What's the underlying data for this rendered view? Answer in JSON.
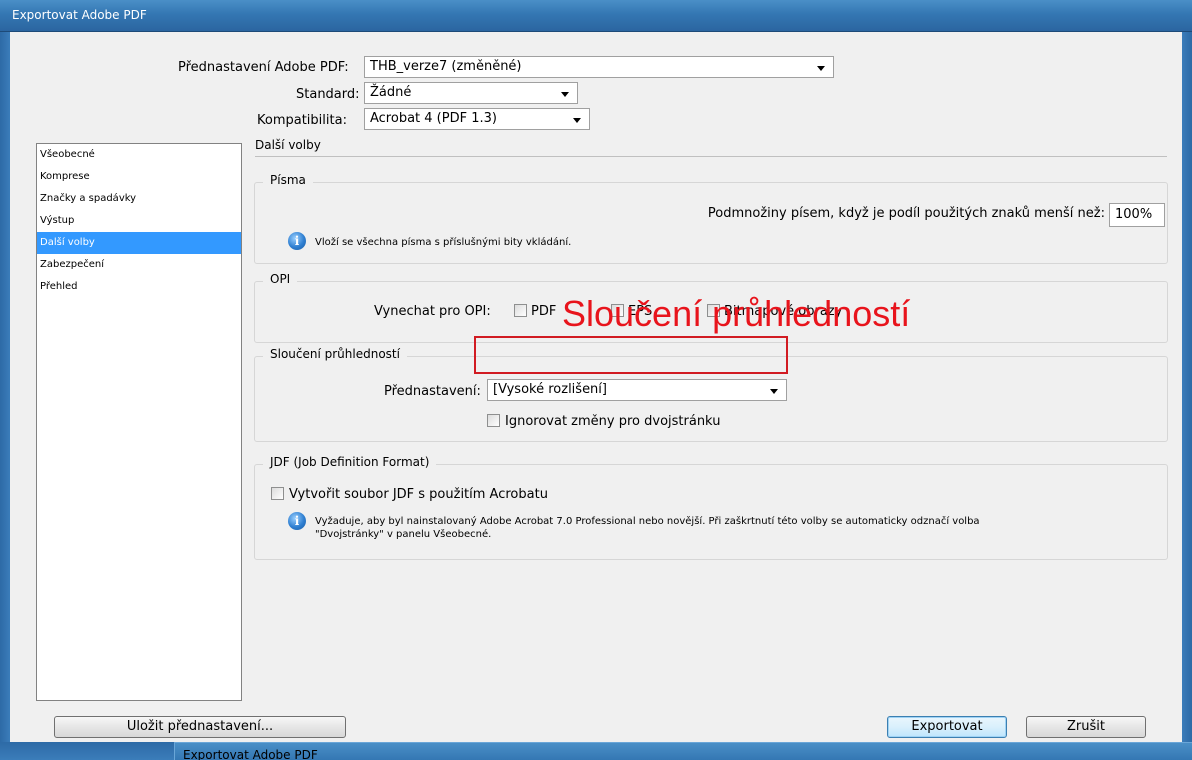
{
  "window": {
    "title": "Exportovat Adobe PDF"
  },
  "presets": {
    "preset_label": "Přednastavení Adobe PDF:",
    "preset_value": "THB_verze7 (změněné)",
    "standard_label": "Standard:",
    "standard_value": "Žádné",
    "compat_label": "Kompatibilita:",
    "compat_value": "Acrobat 4 (PDF 1.3)"
  },
  "sidebar": {
    "items": [
      {
        "label": "Všeobecné"
      },
      {
        "label": "Komprese"
      },
      {
        "label": "Značky a spadávky"
      },
      {
        "label": "Výstup"
      },
      {
        "label": "Další volby"
      },
      {
        "label": "Zabezpečení"
      },
      {
        "label": "Přehled"
      }
    ],
    "selected_index": 4
  },
  "main": {
    "section_title": "Další volby",
    "fonts": {
      "legend": "Písma",
      "subset_label": "Podmnožiny písem, když je podíl použitých znaků menší než:",
      "subset_value": "100%",
      "info": "Vloží se všechna písma s příslušnými bity vkládání."
    },
    "opi": {
      "legend": "OPI",
      "omit_label": "Vynechat pro OPI:",
      "pdf_label": "PDF",
      "eps_label": "EPS",
      "bitmap_label": "Bitmapové obrazy"
    },
    "flattener": {
      "legend": "Sloučení průhledností",
      "preset_label": "Přednastavení:",
      "preset_value": "[Vysoké rozlišení]",
      "ignore_label": "Ignorovat změny pro dvojstránku"
    },
    "jdf": {
      "legend": "JDF (Job Definition Format)",
      "create_label": "Vytvořit soubor JDF s použitím Acrobatu",
      "info_line1": "Vyžaduje, aby byl nainstalovaný Adobe Acrobat 7.0 Professional nebo novější. Při zaškrtnutí této volby se automaticky odznačí volba",
      "info_line2": "\"Dvojstránky\" v panelu Všeobecné."
    }
  },
  "annotation": {
    "text": "Sloučení průhledností",
    "color": "#e8141c"
  },
  "buttons": {
    "save_preset": "Uložit přednastavení...",
    "export": "Exportovat",
    "cancel": "Zrušit"
  },
  "background_window": {
    "title": "Exportovat Adobe PDF"
  },
  "colors": {
    "selection": "#3399ff",
    "titlebar": "#3477b3"
  }
}
